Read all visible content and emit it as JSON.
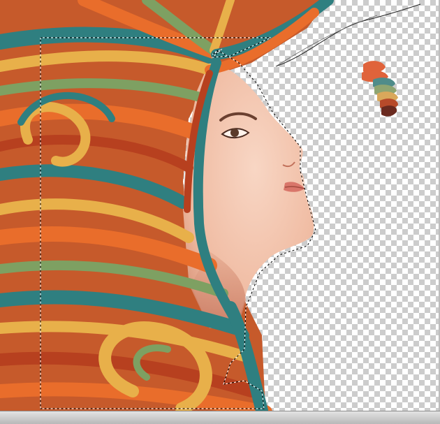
{
  "document": {
    "layer": "hair-illustration-layer",
    "background": "transparency-checkerboard"
  },
  "palette": {
    "swatches": [
      "#e0633b",
      "#4f8c8a",
      "#d9a85b",
      "#8fa571",
      "#b74a2a",
      "#6a2a1f"
    ]
  },
  "colors": {
    "teal": "#2f7f80",
    "orange": "#e96d2b",
    "yellow": "#e8b04a",
    "green": "#7ea062",
    "red": "#b7401f",
    "dark": "#5a2418",
    "skin": "#f3c4ad",
    "skinShade": "#e0a087"
  },
  "tools": {
    "selection": "rectangular-marquee",
    "path": "pen-path"
  }
}
